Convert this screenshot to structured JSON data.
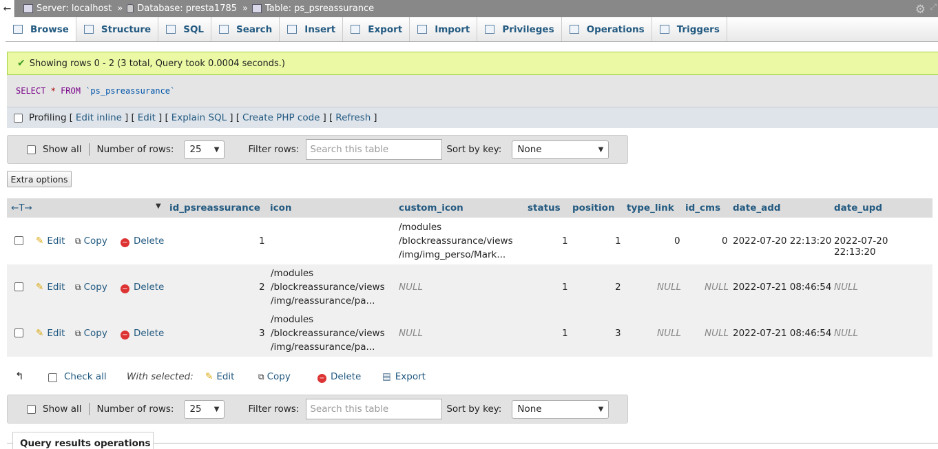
{
  "breadcrumb": {
    "server": "Server: localhost",
    "database": "Database: presta1785",
    "table": "Table: ps_psreassurance"
  },
  "tabs": [
    {
      "label": "Browse",
      "icon": "browse-icon"
    },
    {
      "label": "Structure",
      "icon": "structure-icon"
    },
    {
      "label": "SQL",
      "icon": "sql-icon"
    },
    {
      "label": "Search",
      "icon": "search-icon"
    },
    {
      "label": "Insert",
      "icon": "insert-icon"
    },
    {
      "label": "Export",
      "icon": "export-icon"
    },
    {
      "label": "Import",
      "icon": "import-icon"
    },
    {
      "label": "Privileges",
      "icon": "privileges-icon"
    },
    {
      "label": "Operations",
      "icon": "operations-icon"
    },
    {
      "label": "Triggers",
      "icon": "triggers-icon"
    }
  ],
  "message": "Showing rows 0 - 2 (3 total, Query took 0.0004 seconds.)",
  "sql": {
    "select": "SELECT",
    "star": "*",
    "from": "FROM",
    "table": "`ps_psreassurance`"
  },
  "profiling": {
    "label": "Profiling",
    "links": [
      "Edit inline",
      "Edit",
      "Explain SQL",
      "Create PHP code",
      "Refresh"
    ]
  },
  "nav": {
    "show_all": "Show all",
    "num_rows_label": "Number of rows:",
    "num_rows_value": "25",
    "filter_label": "Filter rows:",
    "filter_placeholder": "Search this table",
    "sort_label": "Sort by key:",
    "sort_value": "None"
  },
  "extra_options": "Extra options",
  "columns": [
    "id_psreassurance",
    "icon",
    "custom_icon",
    "status",
    "position",
    "type_link",
    "id_cms",
    "date_add",
    "date_upd"
  ],
  "row_actions": {
    "edit": "Edit",
    "copy": "Copy",
    "delete": "Delete"
  },
  "rows": [
    {
      "id": "1",
      "icon": [
        "",
        "",
        ""
      ],
      "custom_icon": [
        "/modules",
        "/blockreassurance/views",
        "/img/img_perso/Mark..."
      ],
      "status": "1",
      "position": "1",
      "type_link": "0",
      "id_cms": "0",
      "date_add": "2022-07-20 22:13:20",
      "date_upd": "2022-07-20 22:13:20"
    },
    {
      "id": "2",
      "icon": [
        "/modules",
        "/blockreassurance/views",
        "/img/reassurance/pa..."
      ],
      "custom_icon": [
        "NULL"
      ],
      "status": "1",
      "position": "2",
      "type_link": "NULL",
      "id_cms": "NULL",
      "date_add": "2022-07-21 08:46:54",
      "date_upd": "NULL"
    },
    {
      "id": "3",
      "icon": [
        "/modules",
        "/blockreassurance/views",
        "/img/reassurance/pa..."
      ],
      "custom_icon": [
        "NULL"
      ],
      "status": "1",
      "position": "3",
      "type_link": "NULL",
      "id_cms": "NULL",
      "date_add": "2022-07-21 08:46:54",
      "date_upd": "NULL"
    }
  ],
  "with_selected": {
    "check_all": "Check all",
    "label": "With selected:",
    "edit": "Edit",
    "copy": "Copy",
    "delete": "Delete",
    "export": "Export"
  },
  "query_results_ops": "Query results operations"
}
